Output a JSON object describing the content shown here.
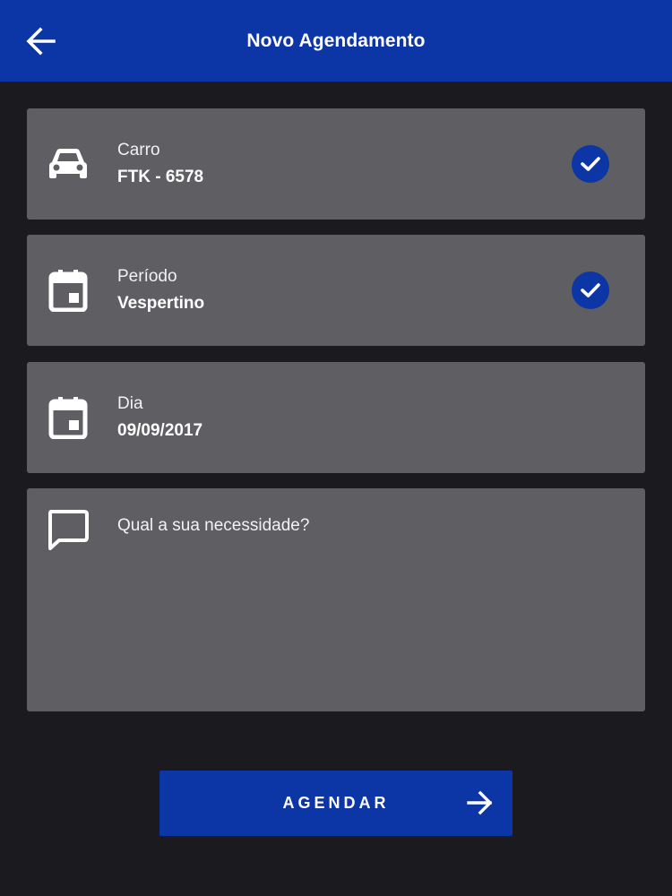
{
  "appbar": {
    "title": "Novo Agendamento",
    "back_icon": "arrow-left-icon",
    "color": "#0c35a5"
  },
  "fields": {
    "carro": {
      "label": "Carro",
      "value": "FTK - 6578",
      "icon": "car-icon",
      "checked": true
    },
    "periodo": {
      "label": "Período",
      "value": "Vespertino",
      "icon": "calendar-icon",
      "checked": true
    },
    "dia": {
      "label": "Dia",
      "value": "09/09/2017",
      "icon": "calendar-icon",
      "checked": false
    },
    "necessidade": {
      "placeholder": "Qual a sua necessidade?",
      "value": "",
      "icon": "comment-icon"
    }
  },
  "cta": {
    "label": "AGENDAR",
    "icon": "arrow-right-icon"
  },
  "colors": {
    "background": "#1a1a1f",
    "card": "#5f5f63",
    "accent": "#0c35a5"
  }
}
